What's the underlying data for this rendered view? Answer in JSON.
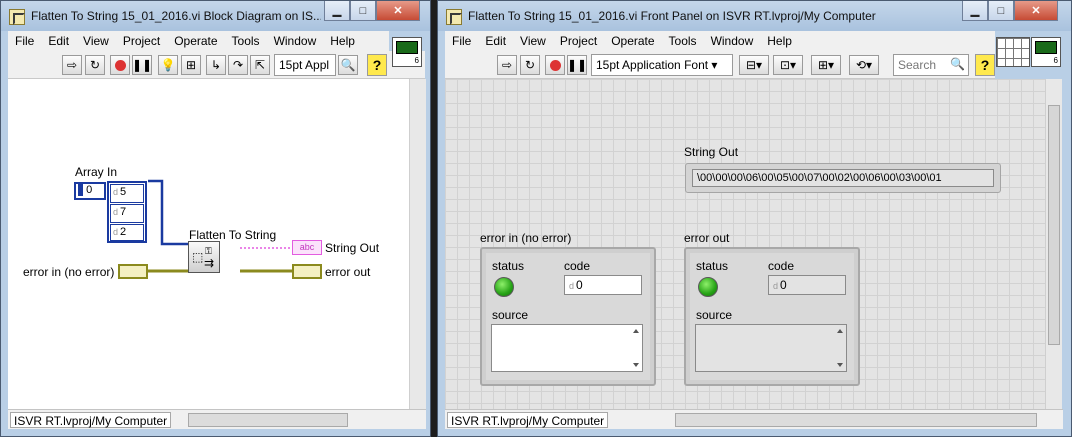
{
  "block_diagram": {
    "title": "Flatten To String 15_01_2016.vi Block Diagram on IS...",
    "menu": [
      "File",
      "Edit",
      "View",
      "Project",
      "Operate",
      "Tools",
      "Window",
      "Help"
    ],
    "font_select": "15pt Appl",
    "vi_icon_number": "6",
    "array_label": "Array In",
    "array_index": "0",
    "array_values": [
      "5",
      "7",
      "2"
    ],
    "numeric_radix": "d",
    "function_label": "Flatten To String",
    "string_out_label": "String Out",
    "string_terminal_text": "abc",
    "error_in_label": "error in (no error)",
    "error_out_label": "error out",
    "context": "ISVR RT.lvproj/My Computer"
  },
  "front_panel": {
    "title": "Flatten To String 15_01_2016.vi Front Panel on ISVR RT.lvproj/My Computer",
    "menu": [
      "File",
      "Edit",
      "View",
      "Project",
      "Operate",
      "Tools",
      "Window",
      "Help"
    ],
    "font_select": "15pt Application Font",
    "search_placeholder": "Search",
    "vi_icon_number": "6",
    "string_out_label": "String Out",
    "string_out_value": "\\00\\00\\00\\06\\00\\05\\00\\07\\00\\02\\00\\06\\00\\03\\00\\01",
    "error_in": {
      "label": "error in (no error)",
      "status_label": "status",
      "code_label": "code",
      "code_value": "0",
      "source_label": "source",
      "source_value": ""
    },
    "error_out": {
      "label": "error out",
      "status_label": "status",
      "code_label": "code",
      "code_value": "0",
      "source_label": "source",
      "source_value": ""
    },
    "context": "ISVR RT.lvproj/My Computer"
  },
  "colors": {
    "wire_int": "#1a3aa0",
    "wire_string": "#e35ce0",
    "wire_cluster": "#8b8a1e",
    "status_led": "#2fb81a"
  }
}
